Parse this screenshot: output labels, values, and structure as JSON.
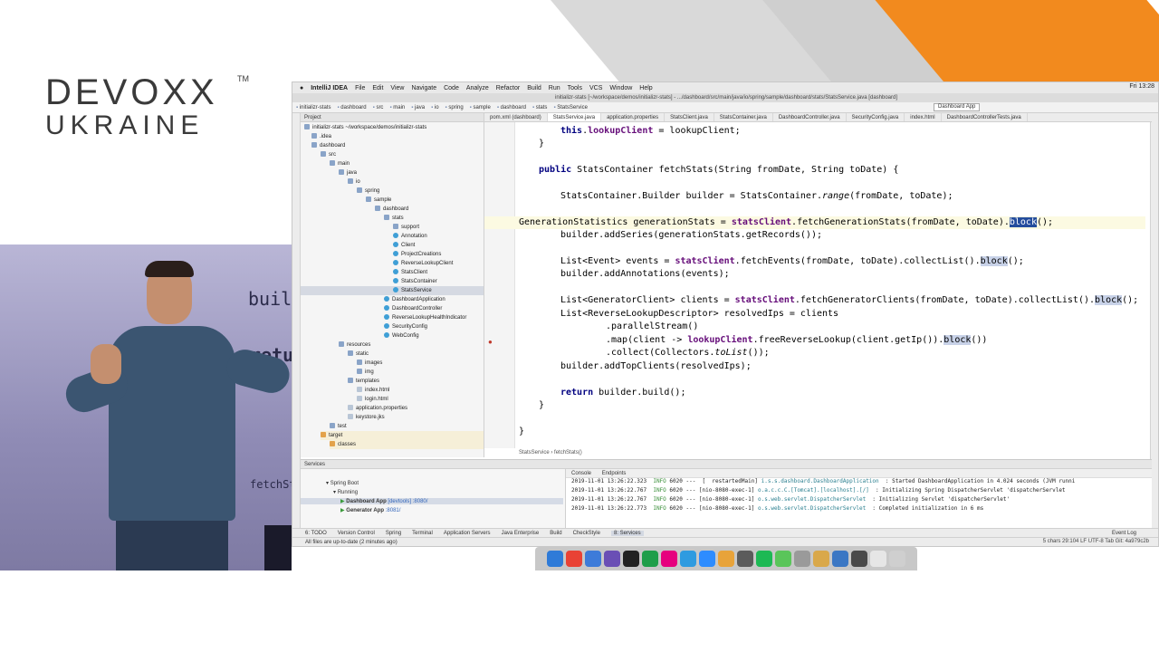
{
  "logo": {
    "line1": "DEVOXX",
    "line2": "UKRAINE",
    "tm": "TM"
  },
  "speaker_screen": {
    "word1": "buil",
    "word2": "retu",
    "word3": "fetchSt"
  },
  "menubar": {
    "app": "IntelliJ IDEA",
    "items": [
      "File",
      "Edit",
      "View",
      "Navigate",
      "Code",
      "Analyze",
      "Refactor",
      "Build",
      "Run",
      "Tools",
      "VCS",
      "Window",
      "Help"
    ],
    "clock": "Fri 13:28"
  },
  "window_title": "initializr-stats [~/workspace/demos/initializr-stats] - .../dashboard/src/main/java/io/spring/sample/dashboard/stats/StatsService.java [dashboard]",
  "navbar": {
    "crumbs": [
      "initializr-stats",
      "dashboard",
      "src",
      "main",
      "java",
      "io",
      "spring",
      "sample",
      "dashboard",
      "stats",
      "StatsService"
    ],
    "run_config": "Dashboard App"
  },
  "project_panel": {
    "title": "Project",
    "root": "initializr-stats ~/workspace/demos/initializr-stats",
    "items": [
      ".idea",
      "dashboard",
      "src",
      "main",
      "java",
      "io",
      "spring",
      "sample",
      "dashboard",
      "stats",
      "support",
      "Annotation",
      "Client",
      "ProjectCreations",
      "ReverseLookupClient",
      "StatsClient",
      "StatsContainer",
      "StatsService",
      "DashboardApplication",
      "DashboardController",
      "ReverseLookupHealthIndicator",
      "SecurityConfig",
      "WebConfig",
      "resources",
      "static",
      "images",
      "img",
      "templates",
      "index.html",
      "login.html",
      "application.properties",
      "keystore.jks",
      "test",
      "target",
      "classes"
    ]
  },
  "editor_tabs": [
    "pom.xml (dashboard)",
    "StatsService.java",
    "application.properties",
    "StatsClient.java",
    "StatsContainer.java",
    "DashboardController.java",
    "SecurityConfig.java",
    "index.html",
    "DashboardControllerTests.java"
  ],
  "editor_breadcrumb": {
    "cls": "StatsService",
    "method": "fetchStats()"
  },
  "services": {
    "title": "Services",
    "tree": [
      {
        "label": "Spring Boot",
        "port": ""
      },
      {
        "label": "Running",
        "port": ""
      },
      {
        "label": "Dashboard App",
        "port": "[devtools] :8080/"
      },
      {
        "label": "Generator App",
        "port": ":8081/"
      }
    ],
    "console_tabs": [
      "Console",
      "Endpoints"
    ],
    "logs": [
      {
        "ts": "2019-11-01 13:26:22.323",
        "level": "INFO",
        "pid": "6020",
        "thread": "---  [  restartedMain]",
        "logger": "i.s.s.dashboard.DashboardApplication",
        "msg": ": Started DashboardApplication in 4.024 seconds (JVM runni"
      },
      {
        "ts": "2019-11-01 13:26:22.767",
        "level": "INFO",
        "pid": "6020",
        "thread": "--- [nio-8080-exec-1]",
        "logger": "o.a.c.c.C.[Tomcat].[localhost].[/]",
        "msg": ": Initializing Spring DispatcherServlet 'dispatcherServlet"
      },
      {
        "ts": "2019-11-01 13:26:22.767",
        "level": "INFO",
        "pid": "6020",
        "thread": "--- [nio-8080-exec-1]",
        "logger": "o.s.web.servlet.DispatcherServlet",
        "msg": ": Initializing Servlet 'dispatcherServlet'"
      },
      {
        "ts": "2019-11-01 13:26:22.773",
        "level": "INFO",
        "pid": "6020",
        "thread": "--- [nio-8080-exec-1]",
        "logger": "o.s.web.servlet.DispatcherServlet",
        "msg": ": Completed initialization in 6 ms"
      }
    ]
  },
  "tool_tabs": [
    "6: TODO",
    "Version Control",
    "Spring",
    "Terminal",
    "Application Servers",
    "Java Enterprise",
    "Build",
    "CheckStyle",
    "8: Services"
  ],
  "tool_tab_right": "Event Log",
  "status": {
    "left": "All files are up-to-date (2 minutes ago)",
    "right": "5 chars   29:104   LF   UTF-8   Tab   Git: 4a979c2b"
  },
  "dock_icon_colors": [
    "#2f7bd8",
    "#e94235",
    "#3d7bd9",
    "#6a4fb5",
    "#222222",
    "#1e9e4a",
    "#e6007e",
    "#2f9be0",
    "#2d8cff",
    "#e8a33a",
    "#5b5b5b",
    "#1db954",
    "#5ac55a",
    "#9a9a9a",
    "#d9a84a",
    "#3b77c4",
    "#4a4a4a",
    "#e6e6e6",
    "#cfcfcf"
  ]
}
